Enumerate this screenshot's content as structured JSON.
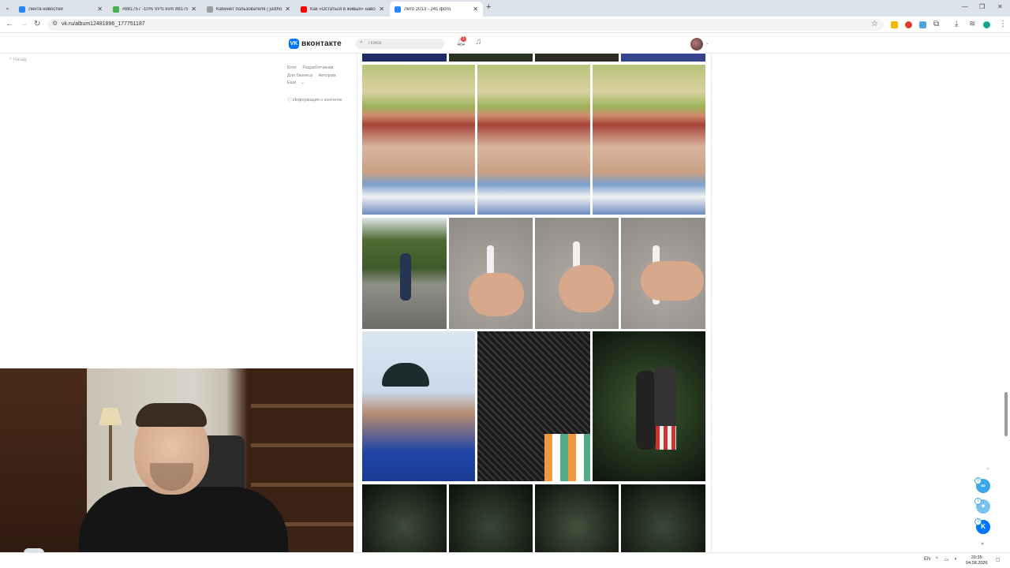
{
  "browser": {
    "tabs": [
      {
        "title": "Лента новостей",
        "color": "#2787f5",
        "active": false
      },
      {
        "title": "#881757 -10% VPS kvm 881757...",
        "color": "#4caf50",
        "active": false
      },
      {
        "title": "Кабинет пользователя | justho...",
        "color": "#9e9e9e",
        "active": false
      },
      {
        "title": "Как «Остаться в живых» навсе...",
        "color": "#ff0000",
        "active": false
      },
      {
        "title": "Лето 2013 - 241 фото",
        "color": "#2787f5",
        "active": true
      }
    ],
    "url": "vk.ru/album12481896_177751187"
  },
  "vk": {
    "logo_text": "VK",
    "brand": "вконтакте",
    "search_placeholder": "Поиск",
    "notifications_count": "1",
    "history_label": "Назад",
    "menu_links": [
      "Блог",
      "Разработчикам",
      "Для бизнеса",
      "Авторам",
      "Ещё"
    ],
    "content_info": "Информация о контенте"
  },
  "photos": {
    "rows": [
      {
        "type": "partial",
        "count": 4
      },
      {
        "type": "selfie",
        "count": 3
      },
      {
        "type": "mixed",
        "count": 4
      },
      {
        "type": "night",
        "count": 3
      },
      {
        "type": "forest",
        "count": 4
      }
    ]
  },
  "widgets": {
    "counts": [
      "0",
      "1",
      "2"
    ]
  },
  "taskbar": {
    "lang": "EN",
    "time": "20:35",
    "date": "04.08.2026"
  },
  "colors": {
    "vk_blue": "#0077ff",
    "badge": "#e64646"
  }
}
